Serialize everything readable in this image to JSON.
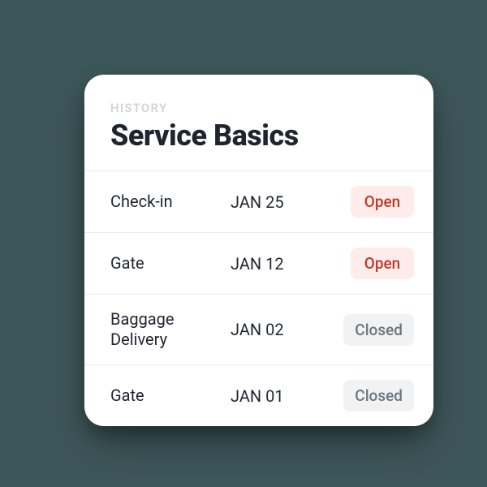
{
  "header": {
    "eyebrow": "HISTORY",
    "title": "Service Basics"
  },
  "status_labels": {
    "open": "Open",
    "closed": "Closed"
  },
  "rows": [
    {
      "name": "Check-in",
      "date": "JAN 25",
      "status": "open"
    },
    {
      "name": "Gate",
      "date": "JAN 12",
      "status": "open"
    },
    {
      "name": "Baggage Delivery",
      "date": "JAN 02",
      "status": "closed"
    },
    {
      "name": "Gate",
      "date": "JAN 01",
      "status": "closed"
    }
  ]
}
